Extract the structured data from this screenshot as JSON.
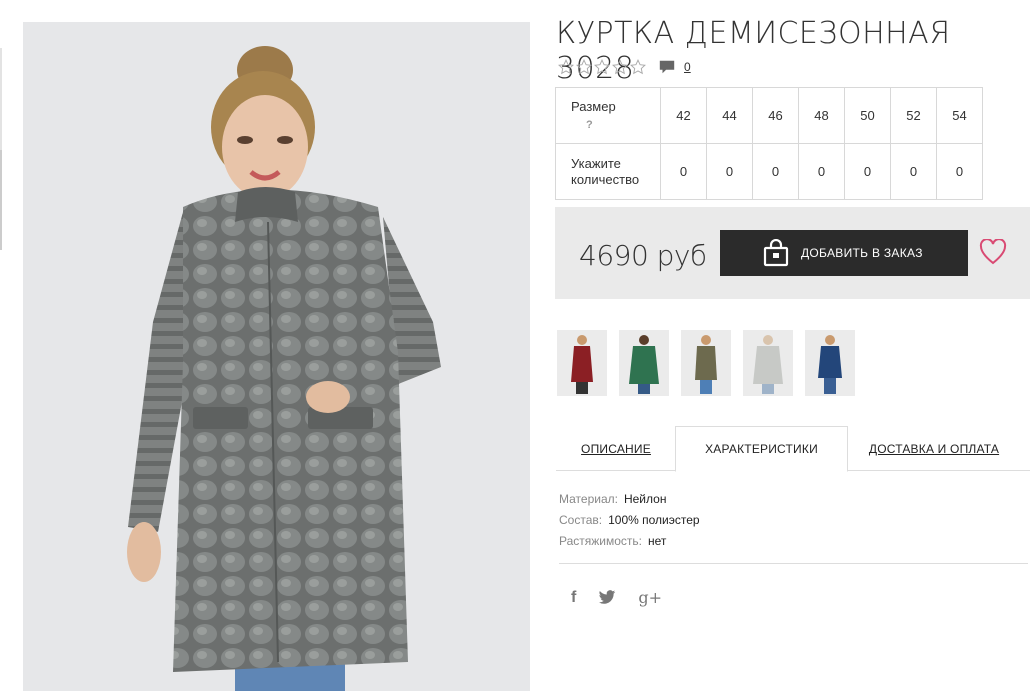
{
  "product": {
    "title": "КУРТКА ДЕМИСЕЗОННАЯ 3028",
    "rating": {
      "stars": 5,
      "filled": 0,
      "comments_count": "0"
    },
    "sizes": {
      "size_label": "Размер",
      "size_help": "?",
      "qty_label_line1": "Укажите",
      "qty_label_line2": "количество",
      "values": [
        "42",
        "44",
        "46",
        "48",
        "50",
        "52",
        "54"
      ],
      "quantities": [
        "0",
        "0",
        "0",
        "0",
        "0",
        "0",
        "0"
      ]
    },
    "price": "4690 руб",
    "add_button_label": "ДОБАВИТЬ В ЗАКАЗ",
    "thumbnails": [
      {
        "name": "thumb-red",
        "color": "#8b1f24"
      },
      {
        "name": "thumb-green",
        "color": "#2f7350"
      },
      {
        "name": "thumb-olive",
        "color": "#6d6a4e"
      },
      {
        "name": "thumb-light-grey",
        "color": "#c7c9c6"
      },
      {
        "name": "thumb-blue",
        "color": "#23467a"
      }
    ]
  },
  "tabs": [
    {
      "label": "ОПИСАНИЕ",
      "active": false
    },
    {
      "label": "ХАРАКТЕРИСТИКИ",
      "active": true
    },
    {
      "label": "ДОСТАВКА И ОПЛАТА",
      "active": false
    }
  ],
  "specs": [
    {
      "key": "Материал:",
      "value": "Нейлон"
    },
    {
      "key": "Состав:",
      "value": "100% полиэстер"
    },
    {
      "key": "Растяжимость:",
      "value": "нет"
    }
  ],
  "social": [
    {
      "icon": "facebook-icon",
      "glyph": "f"
    },
    {
      "icon": "twitter-icon",
      "glyph": "t"
    },
    {
      "icon": "google-plus-icon",
      "glyph": "g+"
    }
  ],
  "colors": {
    "button_bg": "#2b2b2b",
    "heart": "#d94a73",
    "buybox_bg": "#eaeaea",
    "coat": "#6f7271"
  }
}
